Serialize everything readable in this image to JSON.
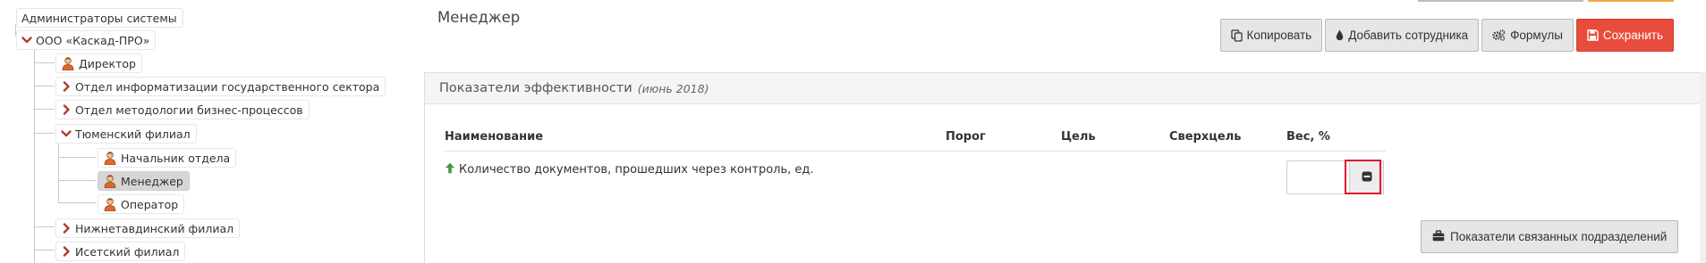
{
  "tree": {
    "root": {
      "label": "Администраторы системы"
    },
    "company": {
      "label": "ООО «Каскад-ПРО»",
      "expanded": true
    },
    "items": [
      {
        "label": "Директор",
        "type": "person"
      },
      {
        "label": "Отдел информатизации государственного сектора",
        "type": "folder-collapsed"
      },
      {
        "label": "Отдел методологии бизнес-процессов",
        "type": "folder-collapsed"
      },
      {
        "label": "Тюменский филиал",
        "type": "folder-expanded",
        "children": [
          {
            "label": "Начальник отдела",
            "type": "person"
          },
          {
            "label": "Менеджер",
            "type": "person",
            "selected": true
          },
          {
            "label": "Оператор",
            "type": "person"
          }
        ]
      },
      {
        "label": "Нижнетавдинский филиал",
        "type": "folder-collapsed"
      },
      {
        "label": "Исетский филиал",
        "type": "folder-collapsed"
      }
    ]
  },
  "page": {
    "title": "Менеджер"
  },
  "toolbar": {
    "copy_label": "Копировать",
    "add_employee_label": "Добавить сотрудника",
    "formulas_label": "Формулы",
    "save_label": "Сохранить"
  },
  "kpi_panel": {
    "title": "Показатели эффективности",
    "period": "(июнь 2018)",
    "columns": {
      "name": "Наименование",
      "threshold": "Порог",
      "target": "Цель",
      "super_target": "Сверхцель",
      "weight": "Вес, %"
    },
    "rows": [
      {
        "name": "Количество документов, прошедших через контроль, ед.",
        "direction": "up",
        "weight_value": ""
      }
    ],
    "related_button_label": "Показатели связанных подразделений"
  },
  "colors": {
    "accent_red": "#e84c3d",
    "chevron": "#a9412b",
    "arrow_up": "#3f9a3f",
    "highlight": "#e0102a"
  },
  "icons": {
    "copy": "copy-icon",
    "add": "drop-icon",
    "formulas": "cogs-icon",
    "save": "floppy-icon",
    "related": "briefcase-icon",
    "remove": "minus-square-icon",
    "person": "user-icon"
  }
}
